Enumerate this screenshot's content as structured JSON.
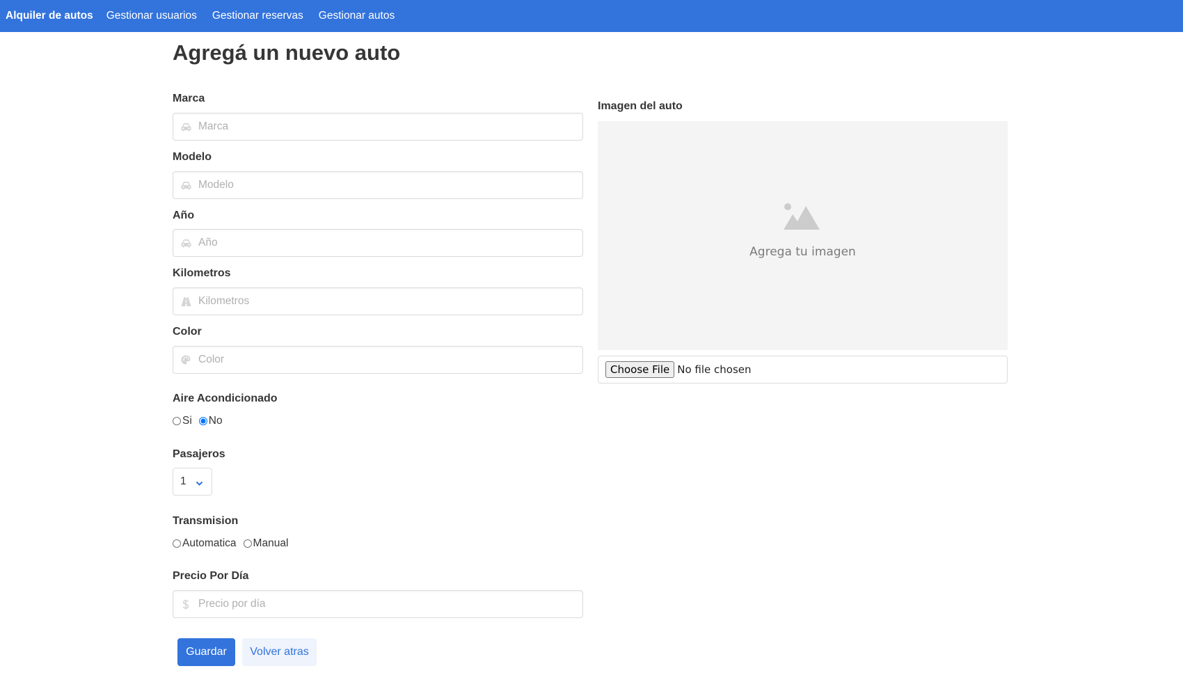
{
  "nav": {
    "brand": "Alquiler de autos",
    "items": [
      "Gestionar usuarios",
      "Gestionar reservas",
      "Gestionar autos"
    ]
  },
  "page": {
    "title": "Agregá un nuevo auto"
  },
  "form": {
    "marca": {
      "label": "Marca",
      "placeholder": "Marca",
      "icon": "car-icon"
    },
    "modelo": {
      "label": "Modelo",
      "placeholder": "Modelo",
      "icon": "car-icon"
    },
    "anio": {
      "label": "Año",
      "placeholder": "Año",
      "icon": "car-icon"
    },
    "kilometros": {
      "label": "Kilometros",
      "placeholder": "Kilometros",
      "icon": "road-icon"
    },
    "color": {
      "label": "Color",
      "placeholder": "Color",
      "icon": "palette-icon"
    },
    "aire": {
      "label": "Aire Acondicionado",
      "options": [
        "Si",
        "No"
      ],
      "selected": "No"
    },
    "pasajeros": {
      "label": "Pasajeros",
      "value": "1"
    },
    "transmision": {
      "label": "Transmision",
      "options": [
        "Automatica",
        "Manual"
      ],
      "selected": ""
    },
    "precio": {
      "label": "Precio Por Día",
      "placeholder": "Precio por día",
      "icon": "dollar-icon"
    }
  },
  "image": {
    "label": "Imagen del auto",
    "placeholder_text": "Agrega tu imagen",
    "icon": "image-icon",
    "file_button": "Choose File",
    "file_status": "No file chosen"
  },
  "buttons": {
    "save": "Guardar",
    "back": "Volver atras"
  },
  "colors": {
    "primary": "#3273dc",
    "light": "#eef3fc",
    "border": "#dbdbdb",
    "placeholder_bg": "#f4f4f4"
  }
}
